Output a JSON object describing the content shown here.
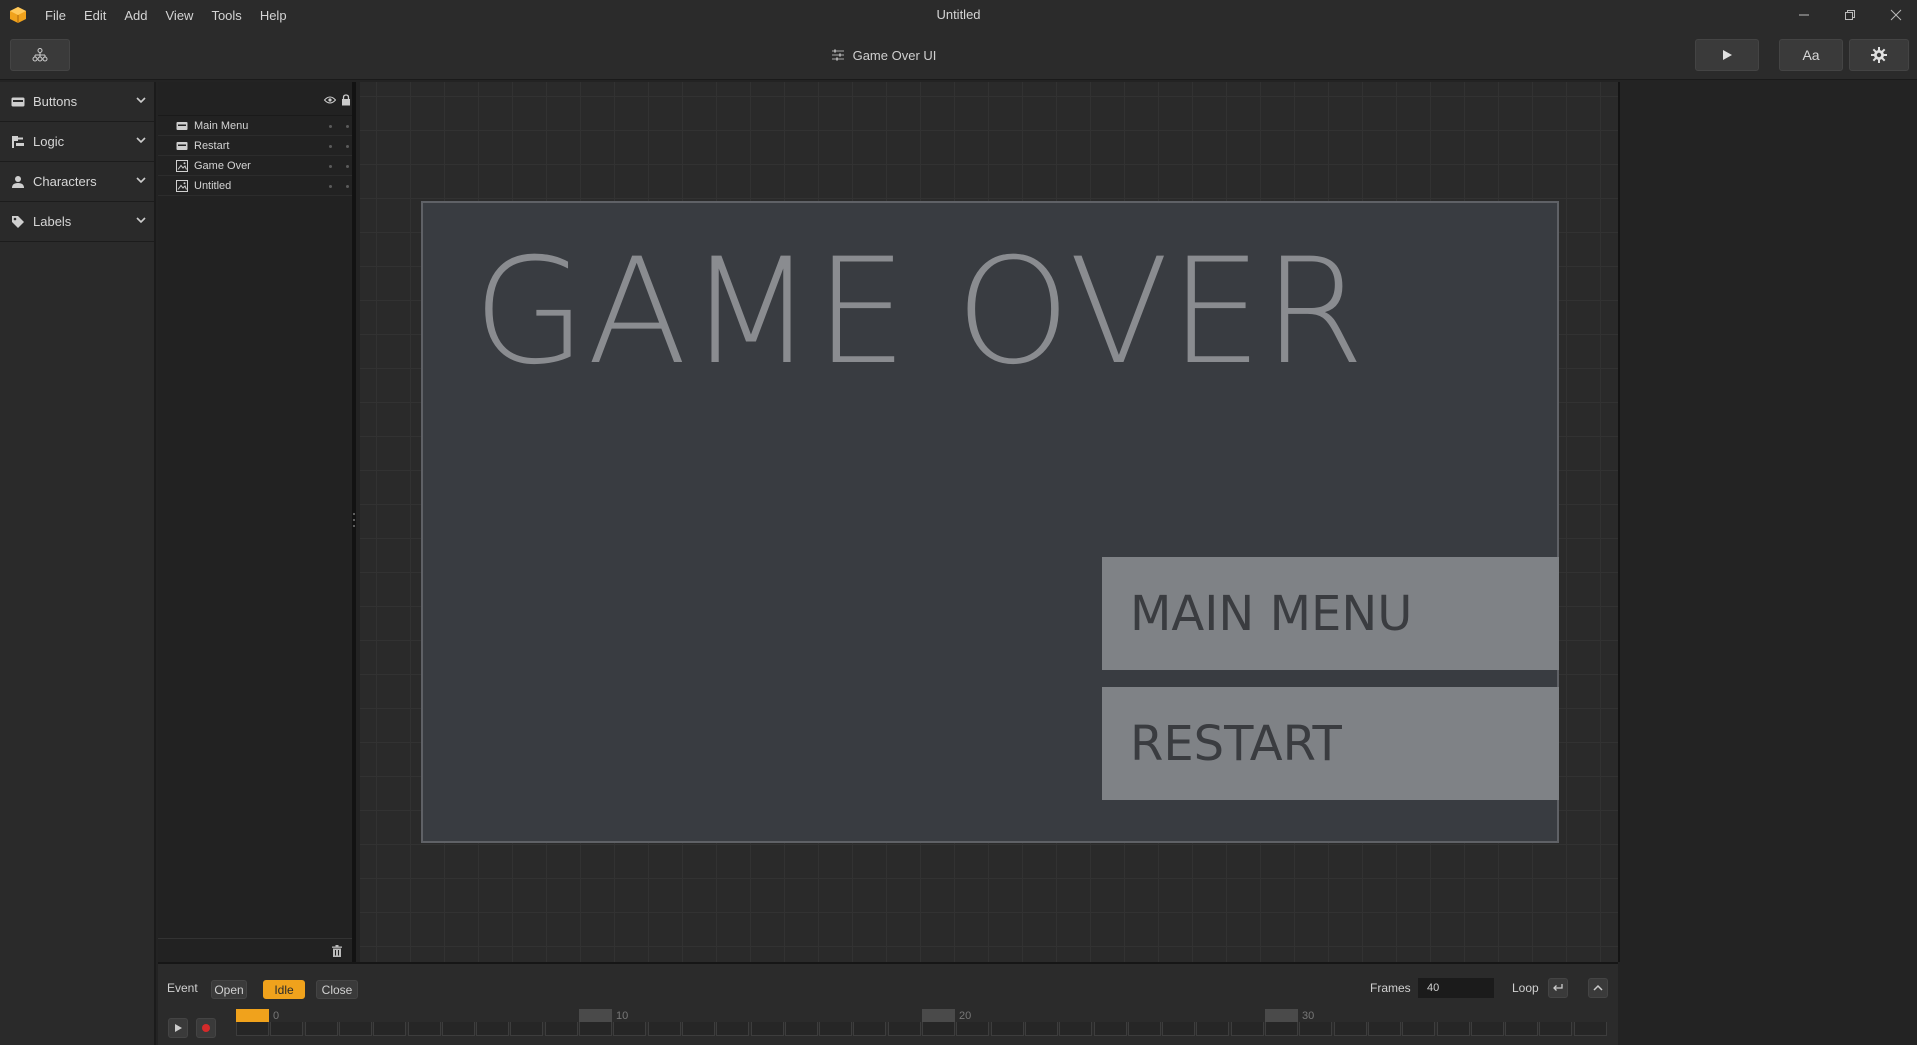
{
  "window": {
    "title": "Untitled",
    "menu": [
      "File",
      "Edit",
      "Add",
      "View",
      "Tools",
      "Help"
    ],
    "controls": [
      "minimize-icon",
      "restore-icon",
      "close-icon"
    ]
  },
  "toolbar": {
    "hierarchy_icon": "hierarchy-icon",
    "document_title": "Game Over UI",
    "font_button_label": "Aa",
    "play_icon": "play-icon",
    "settings_icon": "gear-icon"
  },
  "sidebar": {
    "categories": [
      {
        "label": "Buttons",
        "icon": "button-icon"
      },
      {
        "label": "Logic",
        "icon": "logic-icon"
      },
      {
        "label": "Characters",
        "icon": "person-icon"
      },
      {
        "label": "Labels",
        "icon": "tag-icon"
      }
    ]
  },
  "layers": {
    "items": [
      {
        "name": "Main Menu",
        "icon": "button-icon"
      },
      {
        "name": "Restart",
        "icon": "button-icon"
      },
      {
        "name": "Game Over",
        "icon": "image-icon"
      },
      {
        "name": "Untitled",
        "icon": "image-icon"
      }
    ]
  },
  "canvas": {
    "title_text": "GAME OVER",
    "buttons": [
      "MAIN MENU",
      "RESTART"
    ]
  },
  "timeline": {
    "event_label": "Event",
    "events": [
      "Open",
      "Idle",
      "Close"
    ],
    "active_event": "Idle",
    "frames_label": "Frames",
    "frames_value": "40",
    "loop_label": "Loop",
    "ticks": [
      "0",
      "10",
      "20",
      "30"
    ],
    "colors": {
      "accent": "#f0a21c"
    }
  }
}
